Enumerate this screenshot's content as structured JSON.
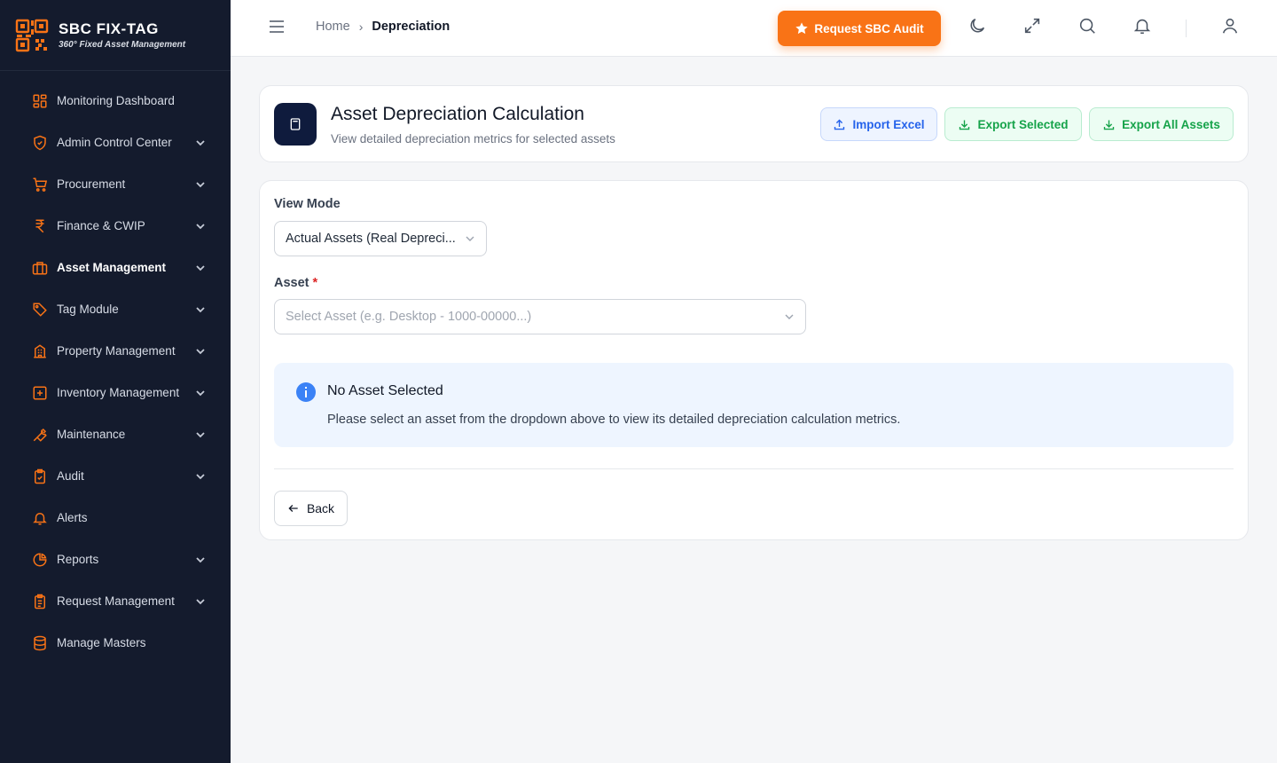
{
  "brand": {
    "name": "SBC FIX-TAG",
    "tagline": "360° Fixed Asset Management"
  },
  "sidebar": {
    "items": [
      {
        "label": "Monitoring Dashboard",
        "icon": "grid-icon",
        "has_children": false
      },
      {
        "label": "Admin Control Center",
        "icon": "shield-check-icon",
        "has_children": true
      },
      {
        "label": "Procurement",
        "icon": "cart-icon",
        "has_children": true
      },
      {
        "label": "Finance & CWIP",
        "icon": "rupee-icon",
        "has_children": true
      },
      {
        "label": "Asset Management",
        "icon": "briefcase-icon",
        "has_children": true,
        "active": true
      },
      {
        "label": "Tag Module",
        "icon": "tag-icon",
        "has_children": true
      },
      {
        "label": "Property Management",
        "icon": "building-icon",
        "has_children": true
      },
      {
        "label": "Inventory Management",
        "icon": "plus-square-icon",
        "has_children": true
      },
      {
        "label": "Maintenance",
        "icon": "wrench-icon",
        "has_children": true
      },
      {
        "label": "Audit",
        "icon": "clipboard-check-icon",
        "has_children": true
      },
      {
        "label": "Alerts",
        "icon": "bell-icon",
        "has_children": false
      },
      {
        "label": "Reports",
        "icon": "pie-chart-icon",
        "has_children": true
      },
      {
        "label": "Request Management",
        "icon": "clipboard-list-icon",
        "has_children": true
      },
      {
        "label": "Manage Masters",
        "icon": "database-icon",
        "has_children": false
      }
    ]
  },
  "header": {
    "breadcrumb": {
      "home": "Home",
      "separator": "›",
      "current": "Depreciation"
    },
    "audit_button": "Request SBC Audit",
    "icons": [
      "moon-icon",
      "expand-icon",
      "search-icon",
      "bell-icon",
      "user-icon"
    ]
  },
  "page": {
    "title": "Asset Depreciation Calculation",
    "subtitle": "View detailed depreciation metrics for selected assets",
    "import_label": "Import Excel",
    "export_selected_label": "Export Selected",
    "export_all_label": "Export All Assets"
  },
  "form": {
    "view_mode_label": "View Mode",
    "view_mode_value": "Actual Assets (Real Depreci...",
    "asset_label": "Asset",
    "required_mark": "*",
    "asset_placeholder": "Select Asset (e.g. Desktop - 1000-00000...)"
  },
  "info": {
    "title": "No Asset Selected",
    "text": "Please select an asset from the dropdown above to view its detailed depreciation calculation metrics."
  },
  "back_label": "Back",
  "colors": {
    "sidebar_bg": "#141b2d",
    "accent_orange": "#f97316",
    "primary_blue": "#2563eb",
    "success_green": "#16a34a",
    "icon_dark": "#0f1b3d"
  }
}
